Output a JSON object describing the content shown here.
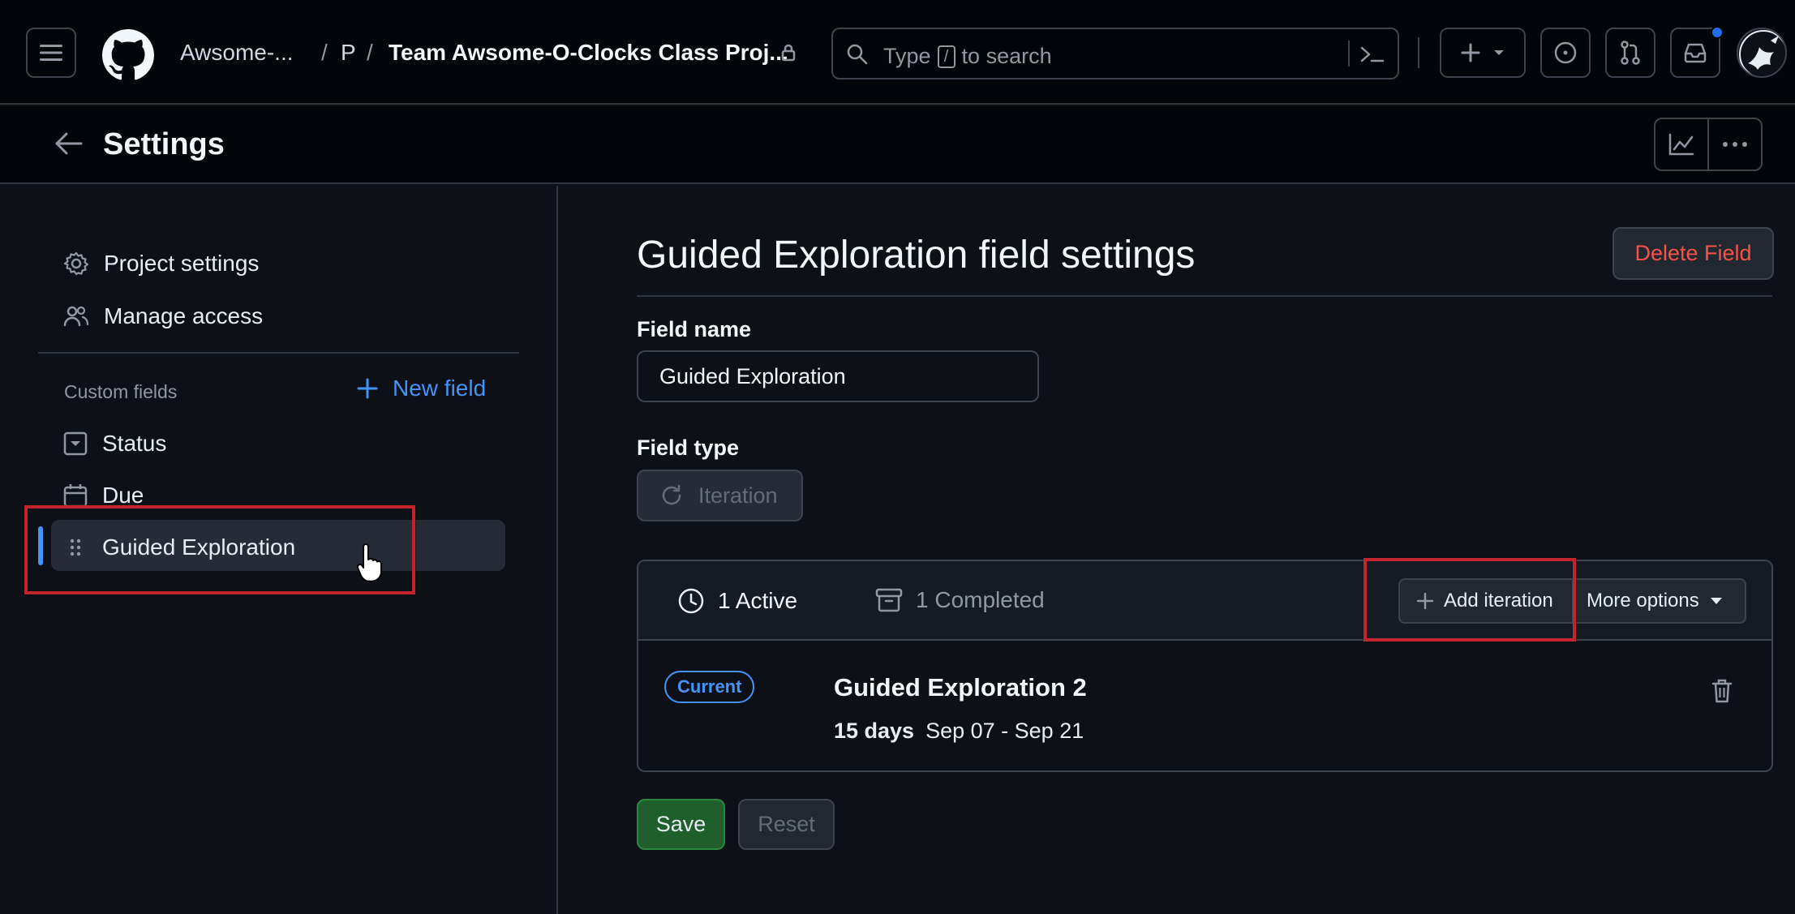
{
  "topbar": {
    "breadcrumb_owner": "Awsome-...",
    "breadcrumb_sep1": "/",
    "breadcrumb_p": "P",
    "breadcrumb_sep2": "/",
    "project_title": "Team Awsome-O-Clocks Class Proj...",
    "search_type": "Type",
    "search_key": "/",
    "search_rest": "to search"
  },
  "subheader": {
    "title": "Settings"
  },
  "sidebar": {
    "items": [
      {
        "label": "Project settings",
        "icon": "gear-icon"
      },
      {
        "label": "Manage access",
        "icon": "people-icon"
      }
    ],
    "custom_fields_label": "Custom fields",
    "new_field_label": "New field",
    "fields": [
      {
        "label": "Status",
        "icon": "single-select-icon"
      },
      {
        "label": "Due",
        "icon": "calendar-icon"
      },
      {
        "label": "Guided Exploration",
        "icon": "drag-handle-icon",
        "active": true
      }
    ]
  },
  "main": {
    "title": "Guided Exploration field settings",
    "delete_label": "Delete Field",
    "field_name_label": "Field name",
    "field_name_value": "Guided Exploration",
    "field_type_label": "Field type",
    "field_type_value": "Iteration",
    "tabs": {
      "active": "1 Active",
      "completed": "1 Completed"
    },
    "add_iteration_label": "Add iteration",
    "more_options_label": "More options",
    "iteration": {
      "badge": "Current",
      "name": "Guided Exploration 2",
      "duration": "15 days",
      "dates": "Sep 07 - Sep 21"
    },
    "save_label": "Save",
    "reset_label": "Reset"
  },
  "colors": {
    "accent": "#4493f8",
    "danger": "#f85149",
    "save_green": "#1f5f2b",
    "highlight_red": "#c2252d"
  }
}
